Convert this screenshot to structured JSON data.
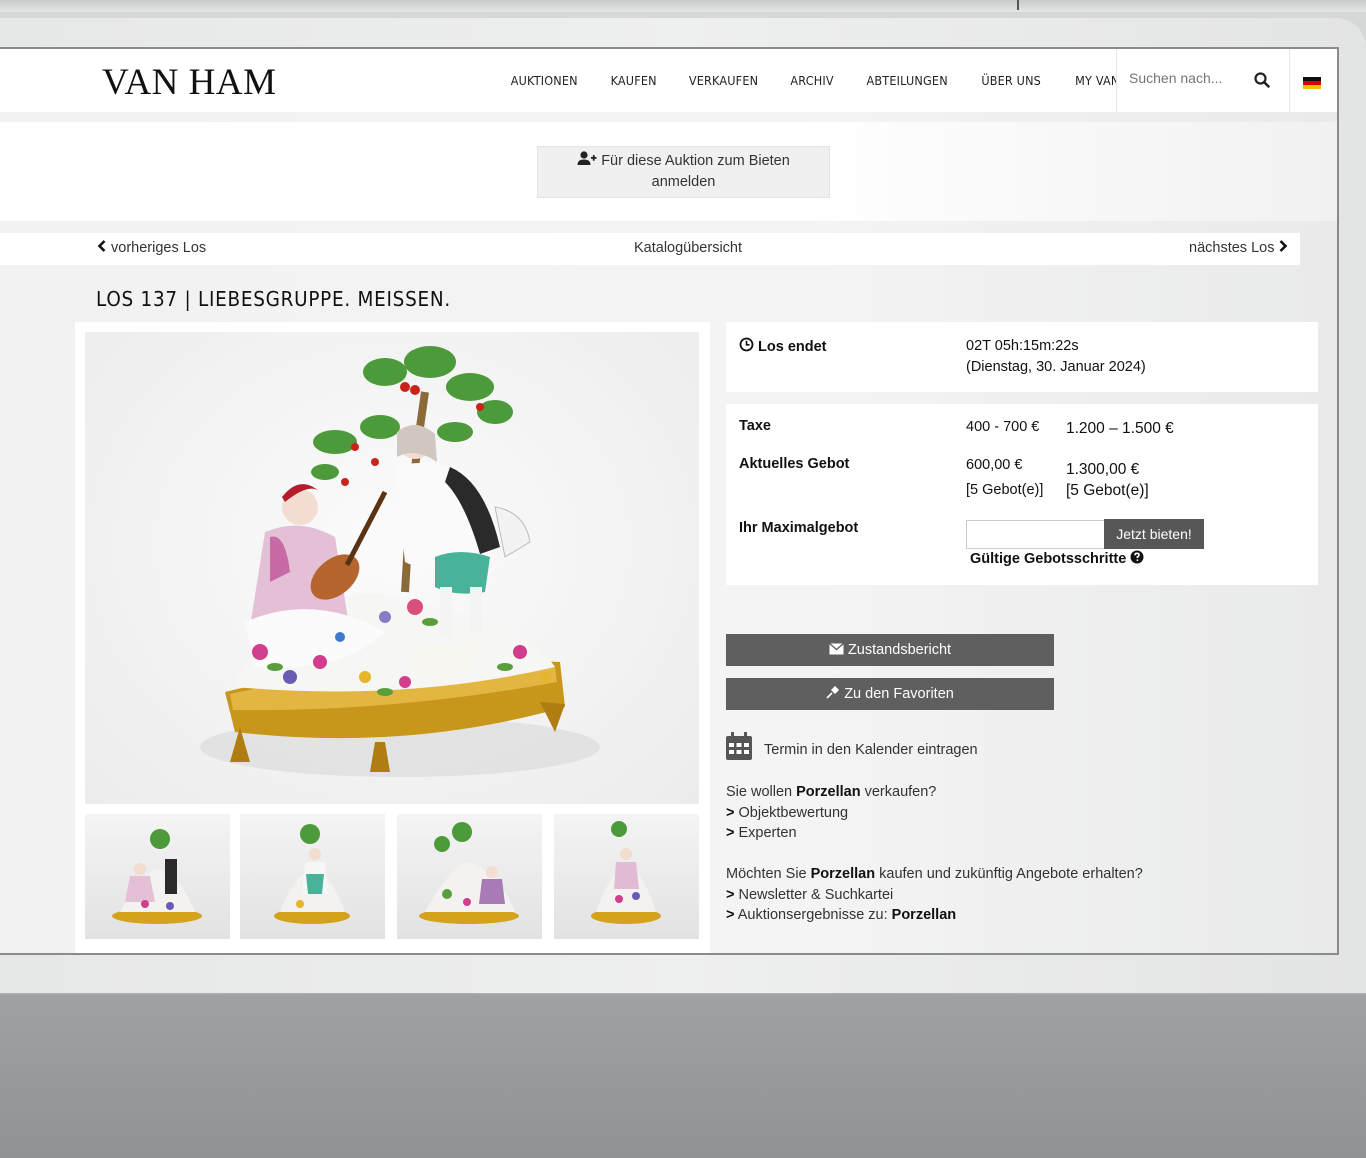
{
  "header": {
    "logo": "VAN HAM",
    "nav": [
      "AUKTIONEN",
      "KAUFEN",
      "VERKAUFEN",
      "ARCHIV",
      "ABTEILUNGEN",
      "ÜBER UNS",
      "MY VAN HAM"
    ],
    "search_placeholder": "Suchen nach..."
  },
  "banner": {
    "register_line1": "Für diese Auktion zum Bieten",
    "register_line2": "anmelden"
  },
  "lotnav": {
    "prev": "vorheriges Los",
    "catalog": "Katalogübersicht",
    "next": "nächstes Los"
  },
  "lot_title": "LOS 137 | LIEBESGRUPPE. MEISSEN.",
  "ends": {
    "label": "Los endet",
    "countdown": "02T 05h:15m:22s",
    "date": "(Dienstag, 30. Januar 2024)"
  },
  "bidding": {
    "taxe_label": "Taxe",
    "taxe_value": "400 - 700 €",
    "taxe_value_alt": "1.200 – 1.500 €",
    "current_label": "Aktuelles Gebot",
    "current_value": "600,00 €",
    "current_bids": "[5 Gebot(e)]",
    "current_value_alt": "1.300,00 €",
    "current_bids_alt": "[5 Gebot(e)]",
    "max_label": "Ihr Maximalgebot",
    "bid_button": "Jetzt bieten!",
    "increments_link": "Gültige Gebotsschritte"
  },
  "actions": {
    "condition_report": "Zustandsbericht",
    "favorites": "Zu den Favoriten",
    "calendar": "Termin in den Kalender eintragen"
  },
  "sell": {
    "prefix": "Sie wollen ",
    "category": "Porzellan",
    "suffix": " verkaufen?",
    "link1": "Objektbewertung",
    "link2": "Experten"
  },
  "buy": {
    "prefix": "Möchten Sie ",
    "category": "Porzellan",
    "suffix": " kaufen und zukünftig Angebote erhalten?",
    "link1": "Newsletter & Suchkartei",
    "link2_prefix": "Auktionsergebnisse zu: ",
    "link2_category": "Porzellan"
  },
  "colors": {
    "dark_button": "#5f5f5f",
    "gold": "#d4a21c"
  }
}
